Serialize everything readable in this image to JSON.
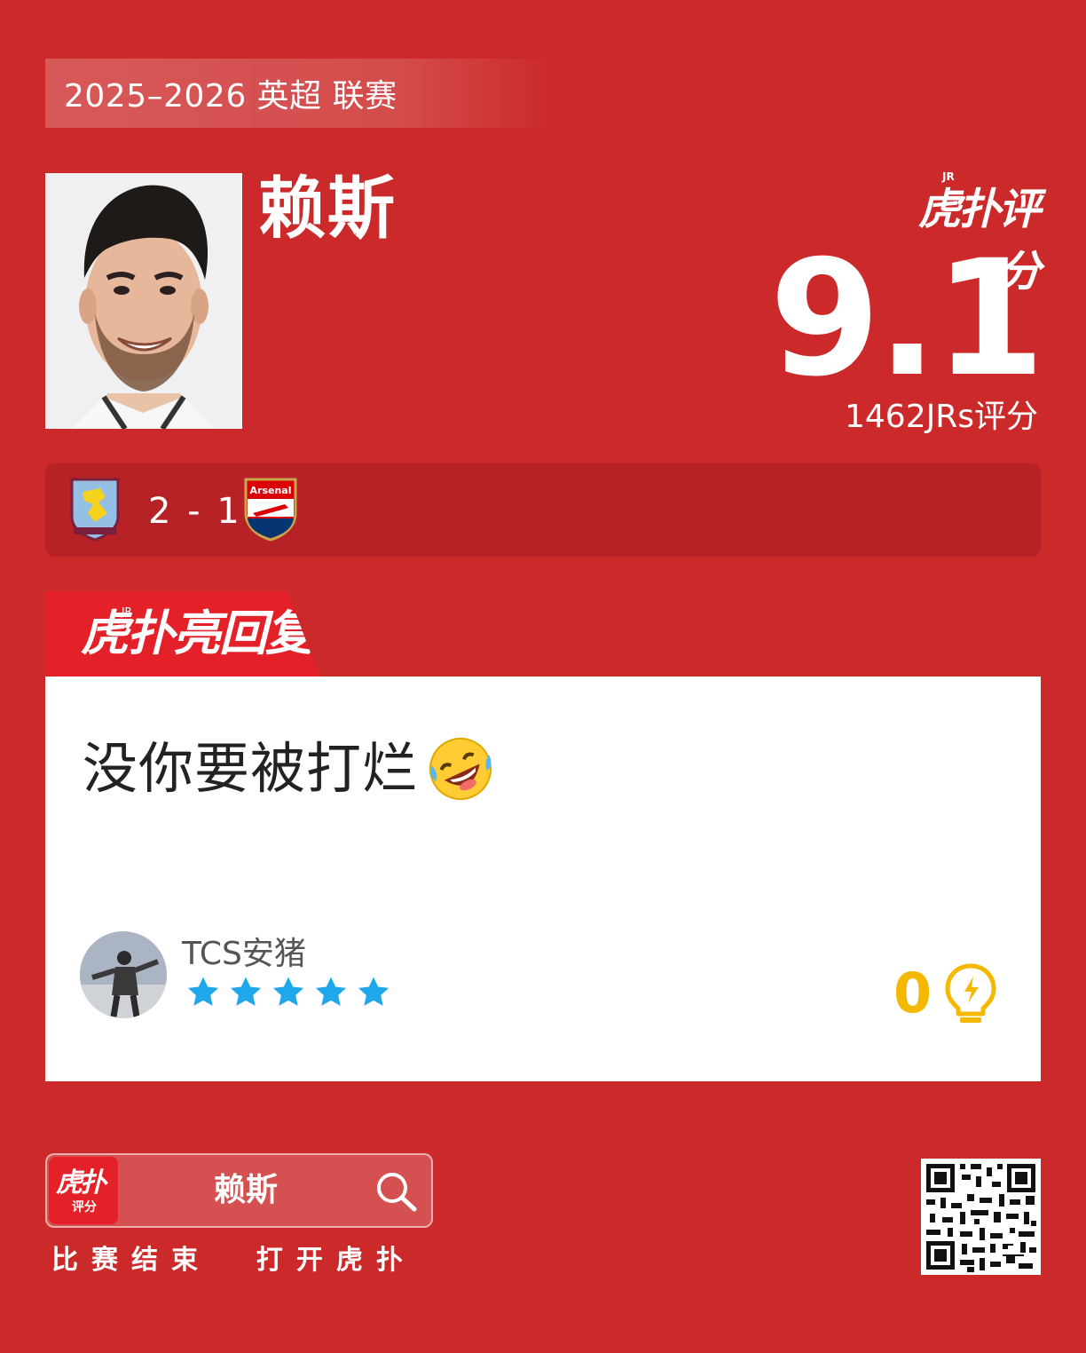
{
  "season": "2025–2026 英超 联赛",
  "player": {
    "name": "赖斯"
  },
  "rating": {
    "brand": "虎扑评分",
    "brand_jr": "JR",
    "score": "9.1",
    "count_label": "1462JRs评分"
  },
  "match": {
    "home_team": "Aston Villa",
    "away_team": "Arsenal",
    "score": "2 - 1"
  },
  "highlight": {
    "title": "虎扑亮回复",
    "jr": "JR"
  },
  "comment": {
    "text": "没你要被打烂",
    "emoji": "rolling-on-floor-laughing",
    "username": "TCS安猪",
    "stars": 5,
    "likes": "0"
  },
  "footer": {
    "app_name_top": "虎扑",
    "app_name_bottom": "评分",
    "search_term": "赖斯",
    "tagline": "比赛结束  打开虎扑"
  },
  "colors": {
    "background": "#cc2a2a",
    "match_bar": "#b62226",
    "accent_red": "#e42128",
    "like_yellow": "#f5b800",
    "star_blue": "#1ea7ec"
  }
}
